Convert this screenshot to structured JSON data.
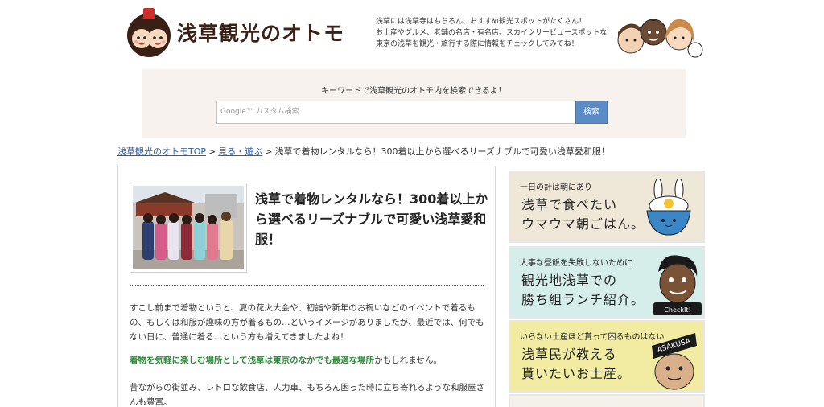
{
  "header": {
    "site_title": "浅草観光のオトモ",
    "intro_lines": [
      "浅草には浅草寺はもちろん、おすすめ観光スポットがたくさん！",
      "お土産やグルメ、老舗の名店・有名店、スカイツリービュースポットな",
      "東京の浅草を観光・旅行する際に情報をチェックしてみてね！"
    ]
  },
  "search": {
    "hint": "キーワードで浅草観光のオトモ内を検索できるよ！",
    "placeholder": "Google™ カスタム検索",
    "button_label": "検索"
  },
  "breadcrumb": {
    "home": "浅草観光のオトモTOP",
    "category": "見る・遊ぶ",
    "current": "浅草で着物レンタルなら！300着以上から選べるリーズナブルで可愛い浅草愛和服！",
    "separator": ">"
  },
  "article": {
    "title": "浅草で着物レンタルなら！300着以上から選べるリーズナブルで可愛い浅草愛和服！",
    "para1": "すこし前まで着物というと、夏の花火大会や、初詣や新年のお祝いなどのイベントで着るもの、もしくは和服が趣味の方が着るもの…というイメージがありましたが、最近では、何でもない日に、普通に着る…という方も増えてきましたよね！",
    "para2_highlight": "着物を気軽に楽しむ場所として浅草は東京のなかでも最適な場所",
    "para2_rest": "かもしれません。",
    "para3": "昔ながらの街並み、レトロな飲食店、人力車、もちろん困った時に立ち寄れるような和服屋さんも豊富。"
  },
  "sidebar": {
    "banners": [
      {
        "small": "一日の計は朝にあり",
        "line1": "浅草で食べたい",
        "line2": "ウマウマ朝ごはん。"
      },
      {
        "small": "大事な昼飯を失敗しないために",
        "line1": "観光地浅草での",
        "line2": "勝ち組ランチ紹介。",
        "badge": "CheckIt!"
      },
      {
        "small": "いらない土産ほど貰って困るものはない",
        "line1": "浅草民が教える",
        "line2": "貰いたいお土産。",
        "badge": "ASAKUSA"
      }
    ]
  },
  "colors": {
    "link": "#2a5ca8",
    "highlight_green": "#2e8b3a",
    "search_button": "#5a8bc7",
    "banner1_bg": "#efe7d7",
    "banner2_bg": "#d6eee9",
    "banner3_bg": "#f2eca2"
  }
}
